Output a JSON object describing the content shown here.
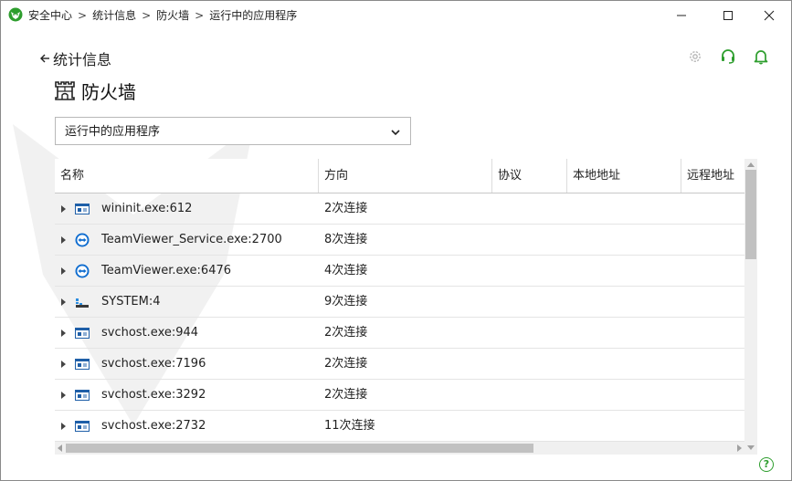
{
  "titlebar": {
    "breadcrumbs": [
      "安全中心",
      "统计信息",
      "防火墙",
      "运行中的应用程序"
    ],
    "separator": ">"
  },
  "header": {
    "back_label": "统计信息",
    "title": "防火墙"
  },
  "colors": {
    "accent": "#2e9e2e",
    "separator": "#dcdcdc",
    "scroll_thumb": "#c1c1c1"
  },
  "dropdown": {
    "selected": "运行中的应用程序"
  },
  "table": {
    "columns": [
      "名称",
      "方向",
      "协议",
      "本地地址",
      "远程地址"
    ],
    "rows": [
      {
        "name": "wininit.exe:612",
        "direction": "2次连接",
        "icon": "window-app-icon"
      },
      {
        "name": "TeamViewer_Service.exe:2700",
        "direction": "8次连接",
        "icon": "teamviewer-icon"
      },
      {
        "name": "TeamViewer.exe:6476",
        "direction": "4次连接",
        "icon": "teamviewer-icon"
      },
      {
        "name": "SYSTEM:4",
        "direction": "9次连接",
        "icon": "system-icon"
      },
      {
        "name": "svchost.exe:944",
        "direction": "2次连接",
        "icon": "window-app-icon"
      },
      {
        "name": "svchost.exe:7196",
        "direction": "2次连接",
        "icon": "window-app-icon"
      },
      {
        "name": "svchost.exe:3292",
        "direction": "2次连接",
        "icon": "window-app-icon"
      },
      {
        "name": "svchost.exe:2732",
        "direction": "11次连接",
        "icon": "window-app-icon"
      }
    ]
  },
  "help": {
    "label": "?"
  }
}
